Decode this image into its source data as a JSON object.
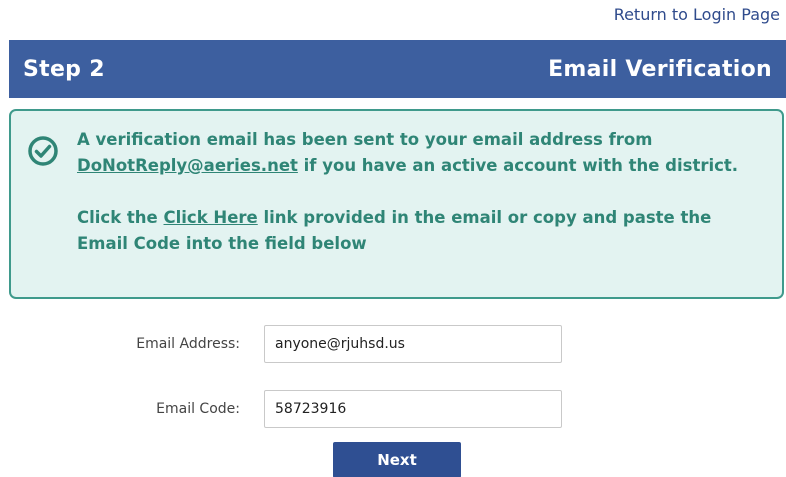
{
  "header": {
    "return_link": "Return to Login Page",
    "step": "Step 2",
    "title": "Email Verification"
  },
  "notice": {
    "icon": "check-circle-icon",
    "line1_before": "A verification email has been sent to your email address from ",
    "email_link": "DoNotReply@aeries.net",
    "line1_after": " if you have an active account with the district.",
    "line2_before": "Click the ",
    "click_here_link": "Click Here",
    "line2_after": " link provided in the email or copy and paste the Email Code into the field below"
  },
  "form": {
    "email_label": "Email Address:",
    "email_value": "anyone@rjuhsd.us",
    "code_label": "Email Code:",
    "code_value": "58723916",
    "next_label": "Next"
  },
  "colors": {
    "header_bg": "#3d5f9f",
    "notice_bg": "#e3f3f1",
    "notice_border": "#3f9a8c",
    "notice_text": "#2f8576",
    "button_bg": "#2f4f92",
    "link": "#2f4b8c"
  }
}
